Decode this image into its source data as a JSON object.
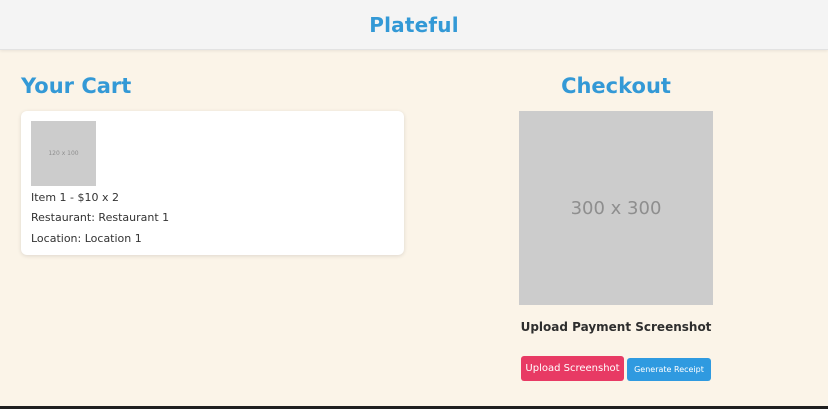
{
  "header": {
    "brand": "Plateful"
  },
  "cart": {
    "title": "Your Cart",
    "items": [
      {
        "thumbnail_placeholder": "120 x 100",
        "summary": "Item 1 - $10 x 2",
        "restaurant": "Restaurant: Restaurant 1",
        "location": "Location: Location 1"
      }
    ]
  },
  "checkout": {
    "title": "Checkout",
    "qr_placeholder": "300 x 300",
    "upload_heading": "Upload Payment Screenshot",
    "upload_button": "Upload Screenshot",
    "receipt_button": "Generate Receipt"
  },
  "colors": {
    "brand_blue": "#3399d6",
    "page_background": "#fbf4e8",
    "upload_button": "#e83a64",
    "receipt_button": "#2f9ae0"
  }
}
